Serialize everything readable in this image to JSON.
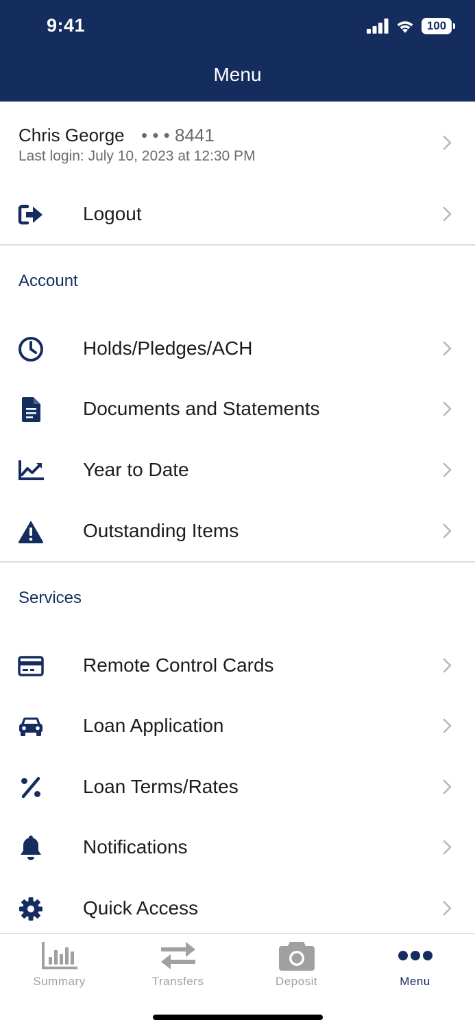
{
  "status_bar": {
    "time": "9:41",
    "battery": "100"
  },
  "header": {
    "title": "Menu"
  },
  "user": {
    "name": "Chris George",
    "account_mask": "• • •  8441",
    "last_login": "Last login: July 10, 2023 at 12:30 PM"
  },
  "logout": {
    "label": "Logout",
    "icon": "logout-icon"
  },
  "account_section": {
    "title": "Account",
    "items": [
      {
        "label": "Holds/Pledges/ACH",
        "icon": "clock-icon"
      },
      {
        "label": "Documents and Statements",
        "icon": "document-icon"
      },
      {
        "label": "Year to Date",
        "icon": "chart-line-icon"
      },
      {
        "label": "Outstanding Items",
        "icon": "warning-icon"
      }
    ]
  },
  "services_section": {
    "title": "Services",
    "items": [
      {
        "label": "Remote Control Cards",
        "icon": "credit-card-icon"
      },
      {
        "label": "Loan Application",
        "icon": "car-icon"
      },
      {
        "label": "Loan Terms/Rates",
        "icon": "percent-icon"
      },
      {
        "label": "Notifications",
        "icon": "bell-icon"
      },
      {
        "label": "Quick Access",
        "icon": "gear-icon"
      }
    ]
  },
  "tabbar": {
    "tabs": [
      {
        "label": "Summary",
        "icon": "bar-chart-icon",
        "active": false
      },
      {
        "label": "Transfers",
        "icon": "arrows-transfer-icon",
        "active": false
      },
      {
        "label": "Deposit",
        "icon": "camera-icon",
        "active": false
      },
      {
        "label": "Menu",
        "icon": "more-dots-icon",
        "active": true
      }
    ]
  },
  "colors": {
    "brand_navy": "#142d5e",
    "inactive_gray": "#a0a0a0",
    "divider": "#dcdcdc"
  }
}
